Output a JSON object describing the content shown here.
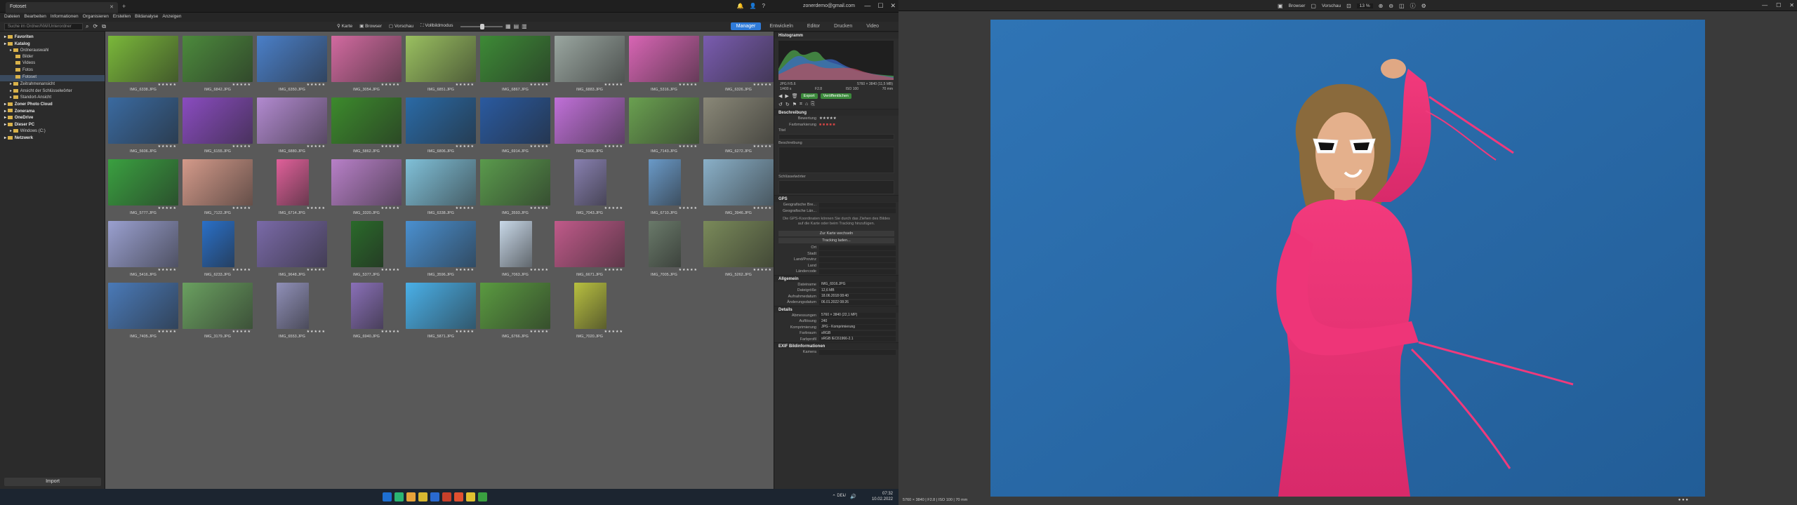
{
  "app": {
    "tab_title": "Fotoset",
    "account": "zonerdemo@gmail.com"
  },
  "menu": [
    "Dateien",
    "Bearbeiten",
    "Informationen",
    "Organisieren",
    "Erstellen",
    "Bildanalyse",
    "Anzeigen"
  ],
  "toolbar": {
    "search_placeholder": "Suche im Ordner/NW/Unterordner",
    "view_modes": [
      "Karte",
      "Browser",
      "Vorschau",
      "Vollbildmodus"
    ],
    "modes": [
      "Manager",
      "Entwickeln",
      "Editor",
      "Drucken",
      "Video"
    ],
    "active_mode": "Manager"
  },
  "sidebar": {
    "items": [
      {
        "label": "Favoriten",
        "count": "",
        "level": 0,
        "bold": true
      },
      {
        "label": "Katalog",
        "count": "",
        "level": 0,
        "bold": true
      },
      {
        "label": "Ordnerauswahl",
        "count": "",
        "level": 1
      },
      {
        "label": "Bilder",
        "count": "",
        "level": 2
      },
      {
        "label": "Videos",
        "count": "",
        "level": 2
      },
      {
        "label": "Fotos",
        "count": "",
        "level": 2
      },
      {
        "label": "Fotoset",
        "count": "",
        "level": 2,
        "selected": true
      },
      {
        "label": "Zeitrahmenansicht",
        "count": "",
        "level": 1
      },
      {
        "label": "Ansicht der Schlüsselwörter",
        "count": "",
        "level": 1
      },
      {
        "label": "Standort-Ansicht",
        "count": "",
        "level": 1
      },
      {
        "label": "Zoner Photo Cloud",
        "count": "",
        "level": 0,
        "bold": true
      },
      {
        "label": "Zonerama",
        "count": "",
        "level": 0,
        "bold": true
      },
      {
        "label": "OneDrive",
        "count": "",
        "level": 0,
        "bold": true
      },
      {
        "label": "Dieser PC",
        "count": "",
        "level": 0,
        "bold": true
      },
      {
        "label": "Windows (C:)",
        "count": "",
        "level": 1
      },
      {
        "label": "Netzwerk",
        "count": "",
        "level": 0,
        "bold": true
      }
    ],
    "import_label": "Import"
  },
  "thumbnails": [
    {
      "name": "IMG_6338.JPG",
      "stars": "★★★★★",
      "color": "#7ab83a"
    },
    {
      "name": "IMG_6842.JPG",
      "stars": "★★★★★",
      "color": "#4c8a3c"
    },
    {
      "name": "IMG_6350.JPG",
      "stars": "★★★★★",
      "color": "#4a7fc8"
    },
    {
      "name": "IMG_3054.JPG",
      "stars": "★★★★★",
      "color": "#d26aa0"
    },
    {
      "name": "IMG_6851.JPG",
      "stars": "★★★★★",
      "color": "#9ac060"
    },
    {
      "name": "IMG_6867.JPG",
      "stars": "★★★★★",
      "color": "#3d8a36"
    },
    {
      "name": "IMG_6883.JPG",
      "stars": "★★★★★",
      "color": "#9aa6a0"
    },
    {
      "name": "IMG_5316.JPG",
      "stars": "★★★★★",
      "color": "#d865b4"
    },
    {
      "name": "IMG_6326.JPG",
      "stars": "★★★★★",
      "color": "#7a5cb0"
    },
    {
      "name": "IMG_5606.JPG",
      "stars": "★★★★★",
      "color": "#3a6aa0"
    },
    {
      "name": "IMG_6155.JPG",
      "stars": "★★★★★",
      "color": "#8a4cc0"
    },
    {
      "name": "IMG_6880.JPG",
      "stars": "★★★★★",
      "color": "#b28ad0"
    },
    {
      "name": "IMG_5862.JPG",
      "stars": "★★★★★",
      "color": "#3c8a2c"
    },
    {
      "name": "IMG_6806.JPG",
      "stars": "★★★★★",
      "color": "#2a6aa6"
    },
    {
      "name": "IMG_6914.JPG",
      "stars": "★★★★★",
      "color": "#2a5aa0"
    },
    {
      "name": "IMG_5906.JPG",
      "stars": "★★★★★",
      "color": "#c070d8"
    },
    {
      "name": "IMG_7143.JPG",
      "stars": "★★★★★",
      "color": "#6aa050"
    },
    {
      "name": "IMG_6272.JPG",
      "stars": "★★★★★",
      "color": "#8a8878"
    },
    {
      "name": "IMG_5777.JPG",
      "stars": "★★★★★",
      "color": "#3aa040"
    },
    {
      "name": "IMG_7122.JPG",
      "stars": "★★★★★",
      "color": "#d49a8a"
    },
    {
      "name": "IMG_6714.JPG",
      "stars": "★★★★★",
      "color": "#e0609a",
      "portrait": true
    },
    {
      "name": "IMG_3320.JPG",
      "stars": "★★★★★",
      "color": "#b880c8"
    },
    {
      "name": "IMG_6338.JPG",
      "stars": "★★★★★",
      "color": "#80c0d8"
    },
    {
      "name": "IMG_3593.JPG",
      "stars": "★★★★★",
      "color": "#5a9a4c"
    },
    {
      "name": "IMG_7043.JPG",
      "stars": "★★★★★",
      "color": "#8880b0",
      "portrait": true
    },
    {
      "name": "IMG_6710.JPG",
      "stars": "★★★★★",
      "color": "#6a9ac8",
      "portrait": true
    },
    {
      "name": "IMG_3946.JPG",
      "stars": "★★★★★",
      "color": "#8ab0c8"
    },
    {
      "name": "IMG_5416.JPG",
      "stars": "★★★★★",
      "color": "#9aa0d0"
    },
    {
      "name": "IMG_6233.JPG",
      "stars": "★★★★★",
      "color": "#2a70c8",
      "portrait": true
    },
    {
      "name": "IMG_9648.JPG",
      "stars": "★★★★★",
      "color": "#7a6aa8"
    },
    {
      "name": "IMG_5377.JPG",
      "stars": "★★★★★",
      "color": "#2a6a2a",
      "portrait": true
    },
    {
      "name": "IMG_3596.JPG",
      "stars": "★★★★★",
      "color": "#4a90d0"
    },
    {
      "name": "IMG_7063.JPG",
      "stars": "★★★★★",
      "color": "#c8d8e8",
      "portrait": true
    },
    {
      "name": "IMG_6671.JPG",
      "stars": "★★★★★",
      "color": "#c05a8a"
    },
    {
      "name": "IMG_7005.JPG",
      "stars": "★★★★★",
      "color": "#6a7a6a",
      "portrait": true
    },
    {
      "name": "IMG_5262.JPG",
      "stars": "★★★★★",
      "color": "#7a8a5a"
    },
    {
      "name": "IMG_7405.JPG",
      "stars": "★★★★★",
      "color": "#4a7ab8"
    },
    {
      "name": "IMG_3179.JPG",
      "stars": "★★★★★",
      "color": "#6aa060"
    },
    {
      "name": "IMG_6553.JPG",
      "stars": "★★★★★",
      "color": "#9090b8",
      "portrait": true
    },
    {
      "name": "IMG_6940.JPG",
      "stars": "★★★★★",
      "color": "#8a70b8",
      "portrait": true
    },
    {
      "name": "IMG_5871.JPG",
      "stars": "★★★★★",
      "color": "#4ab0e8"
    },
    {
      "name": "IMG_6766.JPG",
      "stars": "★★★★★",
      "color": "#5a9a40"
    },
    {
      "name": "IMG_7020.JPG",
      "stars": "★★★★★",
      "color": "#b8c040",
      "portrait": true
    }
  ],
  "panel": {
    "histogram_title": "Histogramm",
    "exif_line1_left": "JPG   F/5.6",
    "exif_line1_right": "5760 × 3840 (11,5 MB)",
    "exif_line2": [
      "1/400 s",
      "F2.8",
      "ISO 100",
      "70 mm"
    ],
    "buttons": {
      "export": "Export",
      "share": "Veröffentlichen"
    },
    "beschreibung_title": "Beschreibung",
    "bewertung_label": "Bewertung",
    "bewertung_value": "★★★★★",
    "farb_label": "Farbmarkierung",
    "titel_label": "Titel",
    "beschreibung_label": "Beschreibung",
    "schluessel_label": "Schlüsselwörter",
    "gps_title": "GPS",
    "gps_rows": [
      "Geografische Bre...",
      "Geografische Län..."
    ],
    "gps_note": "Die GPS-Koordinaten können Sie durch das Ziehen des Bildes auf die Karte oder beim Tracking hinzufügen.",
    "gps_btn1": "Zur Karte wechseln",
    "gps_btn2": "Tracking laden...",
    "location_rows": [
      "Ort",
      "Stadt",
      "Land/Provinz",
      "Land",
      "Ländercode"
    ],
    "allgemein_title": "Allgemein",
    "allgemein": [
      {
        "k": "Dateiname",
        "v": "IMG_6916.JPG"
      },
      {
        "k": "Dateigröße",
        "v": "12,6 MB"
      },
      {
        "k": "Aufnahmedatum",
        "v": "18.06.2018 08:40"
      },
      {
        "k": "Änderungsdatum",
        "v": "06.01.2022 08:26"
      }
    ],
    "details_title": "Details",
    "details": [
      {
        "k": "Abmessungen",
        "v": "5760 × 3840 (22,1 MP)"
      },
      {
        "k": "Auflösung",
        "v": "240"
      },
      {
        "k": "Komprimierung",
        "v": "JPG - Komprimierung"
      },
      {
        "k": "Farbraum",
        "v": "sRGB"
      },
      {
        "k": "Farbprofil",
        "v": "sRGB IEC61966-2.1"
      }
    ],
    "exif_title": "EXIF Bildinformationen",
    "exif_rows": [
      {
        "k": "Kamera",
        "v": ""
      }
    ]
  },
  "taskbar": {
    "lang": "DEU",
    "time": "07:32",
    "date": "10.02.2022",
    "apps": [
      "#1e6fd0",
      "#2bb673",
      "#e8a33a",
      "#d8b830",
      "#2a6ad0",
      "#c8402a",
      "#e05030",
      "#e0c030",
      "#3aa040"
    ]
  },
  "viewer": {
    "buttons": [
      "Browser",
      "Vorschau"
    ],
    "zoom": "13 %",
    "status": "5760 × 3840 | F2.8 | ISO 100 | 70 mm",
    "dots": "● ● ●"
  }
}
